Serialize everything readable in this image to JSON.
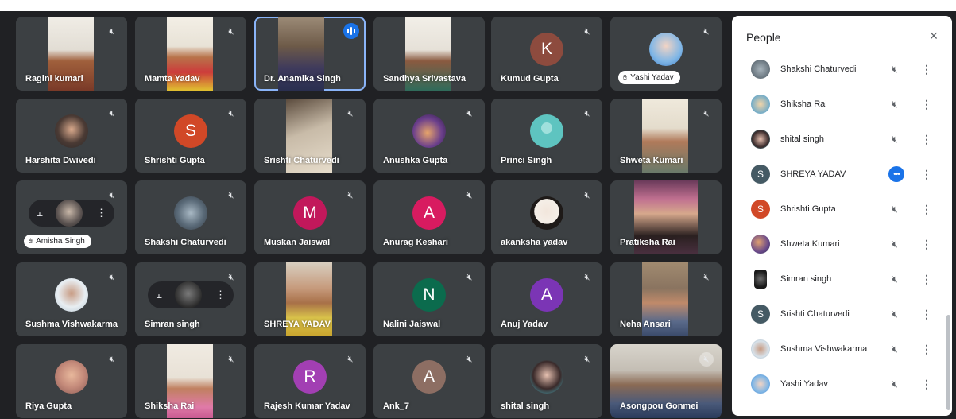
{
  "grid": {
    "tiles": [
      {
        "name": "Ragini kumari"
      },
      {
        "name": "Mamta Yadav"
      },
      {
        "name": "Dr. Anamika Singh"
      },
      {
        "name": "Sandhya Srivastava"
      },
      {
        "name": "Kumud Gupta",
        "letter": "K"
      },
      {
        "name": "Yashi Yadav"
      },
      {
        "name": "Harshita Dwivedi"
      },
      {
        "name": "Shrishti Gupta",
        "letter": "S"
      },
      {
        "name": "Srishti Chaturvedi"
      },
      {
        "name": "Anushka Gupta"
      },
      {
        "name": "Princi Singh"
      },
      {
        "name": "Shweta Kumari"
      },
      {
        "name": "Amisha Singh"
      },
      {
        "name": "Shakshi Chaturvedi"
      },
      {
        "name": "Muskan Jaiswal",
        "letter": "M"
      },
      {
        "name": "Anurag Keshari",
        "letter": "A"
      },
      {
        "name": "akanksha yadav"
      },
      {
        "name": "Pratiksha Rai"
      },
      {
        "name": "Sushma Vishwakarma"
      },
      {
        "name": "Simran singh"
      },
      {
        "name": "SHREYA YADAV"
      },
      {
        "name": "Nalini Jaiswal",
        "letter": "N"
      },
      {
        "name": "Anuj Yadav",
        "letter": "A"
      },
      {
        "name": "Neha Ansari"
      },
      {
        "name": "Riya Gupta"
      },
      {
        "name": "Shiksha Rai"
      },
      {
        "name": "Rajesh Kumar Yadav",
        "letter": "R"
      },
      {
        "name": "Ank_7",
        "letter": "A"
      },
      {
        "name": "shital singh"
      },
      {
        "name": "Asongpou Gonmei"
      }
    ]
  },
  "people_panel": {
    "title": "People",
    "close_icon": "×",
    "people": [
      {
        "name": "Shakshi Chaturvedi"
      },
      {
        "name": "Shiksha Rai"
      },
      {
        "name": "shital singh"
      },
      {
        "name": "SHREYA YADAV",
        "letter": "S"
      },
      {
        "name": "Shrishti Gupta",
        "letter": "S"
      },
      {
        "name": "Shweta Kumari"
      },
      {
        "name": "Simran singh"
      },
      {
        "name": "Srishti Chaturvedi",
        "letter": "S"
      },
      {
        "name": "Sushma Vishwakarma"
      },
      {
        "name": "Yashi Yadav"
      }
    ]
  },
  "icons": {
    "mic_off": "mic-off-icon",
    "more": "more-vert-icon",
    "hand": "raised-hand-icon",
    "pin": "pin-icon",
    "speaking": "audio-level-icon"
  },
  "colors": {
    "tile_bg": "#3c4043",
    "page_bg": "#202124",
    "speaking_outline": "#8ab4f8",
    "accent_blue": "#1a73e8"
  }
}
